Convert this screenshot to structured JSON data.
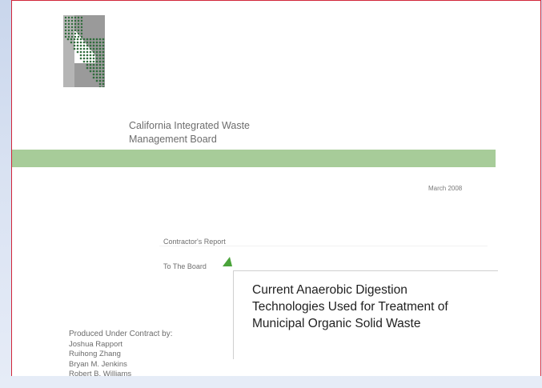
{
  "organization": {
    "line1": "California Integrated Waste",
    "line2": "Management Board"
  },
  "date": "March  2008",
  "contractor_report": "Contractor's Report",
  "to_board": "To The Board",
  "title": {
    "line1": "Current Anaerobic Digestion",
    "line2": "Technologies Used for Treatment of",
    "line3": "Municipal Organic Solid Waste"
  },
  "produced_by": {
    "heading": "Produced Under Contract by:",
    "authors": [
      "Joshua Rapport",
      "Ruihong Zhang",
      "Bryan M. Jenkins",
      "Robert B. Williams"
    ]
  },
  "colors": {
    "accent_green": "#a7cc99",
    "border_red": "#d1263a",
    "logo_green": "#2e6b3a"
  },
  "icons": {
    "logo": "ciwmb-logo",
    "pointer": "green-triangle-icon"
  }
}
